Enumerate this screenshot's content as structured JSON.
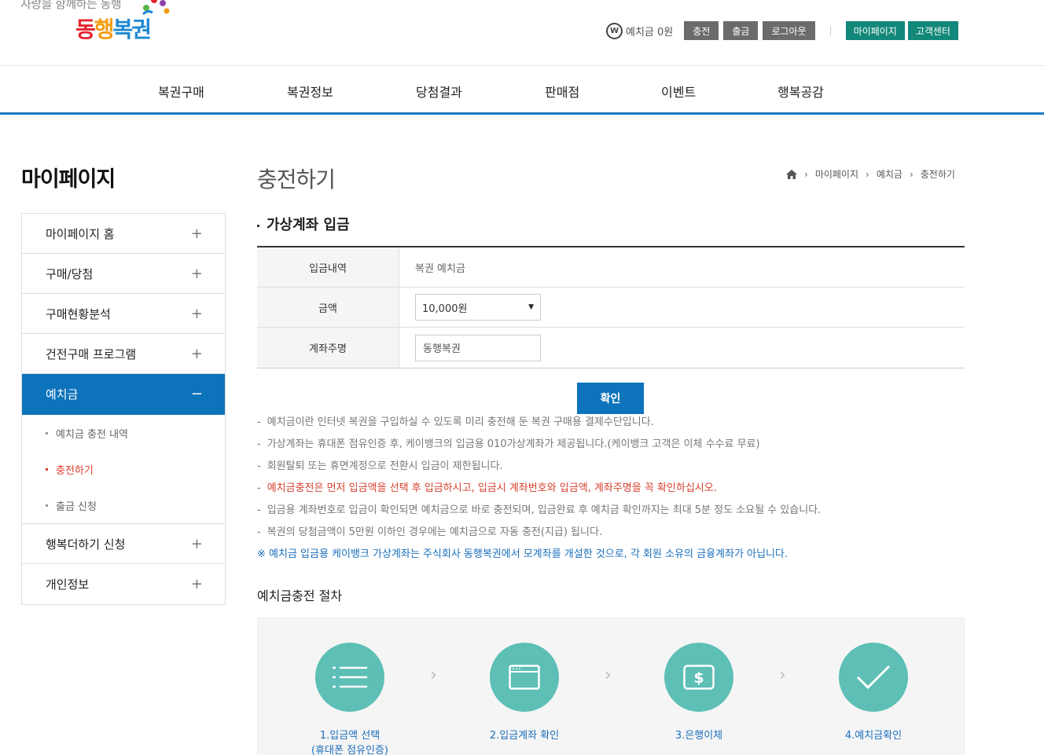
{
  "header": {
    "tagline": "사랑을 함께하는 동행",
    "logo_part1": "동",
    "logo_part2": "행",
    "logo_part3": "복권",
    "won_symbol": "W",
    "deposit": "예치금 0원",
    "btn_charge": "충전",
    "btn_withdraw": "출금",
    "btn_logout": "로그아웃",
    "btn_mypage": "마이페이지",
    "btn_customer": "고객센터"
  },
  "gnb": [
    "복권구매",
    "복권정보",
    "당첨결과",
    "판매점",
    "이벤트",
    "행복공감"
  ],
  "lnb": {
    "title": "마이페이지",
    "items": [
      {
        "label": "마이페이지 홈",
        "icon": "+"
      },
      {
        "label": "구매/당첨",
        "icon": "+"
      },
      {
        "label": "구매현황분석",
        "icon": "+"
      },
      {
        "label": "건전구매 프로그램",
        "icon": "+"
      },
      {
        "label": "예치금",
        "icon": "−"
      },
      {
        "label": "행복더하기 신청",
        "icon": "+"
      },
      {
        "label": "개인정보",
        "icon": "+"
      }
    ],
    "sub": [
      "예치금 충전 내역",
      "충전하기",
      "출금 신청"
    ]
  },
  "content": {
    "page_title": "충전하기",
    "breadcrumb": [
      "마이페이지",
      "예치금",
      "충전하기"
    ],
    "section_title": "가상계좌 입금",
    "form": {
      "row1_label": "입금내역",
      "row1_value": "복권 예치금",
      "row2_label": "금액",
      "row2_value": "10,000원",
      "row3_label": "계좌주명",
      "row3_value": "동행복권"
    },
    "confirm": "확인",
    "notes": [
      "예치금이란 인터넷 복권을 구입하실 수 있도록 미리 충전해 둔 복권 구매용 결제수단입니다.",
      "가상계좌는 휴대폰 점유인증 후, 케이뱅크의 입금용 010가상계좌가 제공됩니다.(케이뱅크 고객은 이체 수수료 무료)",
      "회원탈퇴 또는 휴면계정으로 전환시 입금이 제한됩니다.",
      "예치금충전은 먼저 입금액을 선택 후 입금하시고, 입금시 계좌번호와 입금액, 계좌주명을 꼭 확인하십시오.",
      "입금용 계좌번호로 입금이 확인되면 예치금으로 바로 충전되며, 입금완료 후 예치금 확인까지는 최대 5분 정도 소요될 수 있습니다.",
      "복권의 당첨금액이 5만원 이하인 경우에는 예치금으로 자동 충전(지급) 됩니다."
    ],
    "notice": "※ 예치금 입금용 케이뱅크 가상계좌는 주식회사 동행복권에서 모계좌를 개설한 것으로, 각 회원 소유의 금융계좌가 아닙니다.",
    "process_title": "예치금충전 절차",
    "steps": [
      {
        "label": "1.입금액 선택",
        "label2": "(휴대폰 점유인증)",
        "icon": "list-icon"
      },
      {
        "label": "2.입금계좌 확인",
        "label2": "",
        "icon": "window-icon"
      },
      {
        "label": "3.은행이체",
        "label2": "",
        "icon": "dollar-icon"
      },
      {
        "label": "4.예치금확인",
        "label2": "",
        "icon": "check-icon"
      }
    ]
  },
  "colors": {
    "primary_blue": "#0d73bb",
    "teal": "#12887a",
    "step_teal": "#5dbfb5",
    "alert_red": "#d6402f"
  }
}
